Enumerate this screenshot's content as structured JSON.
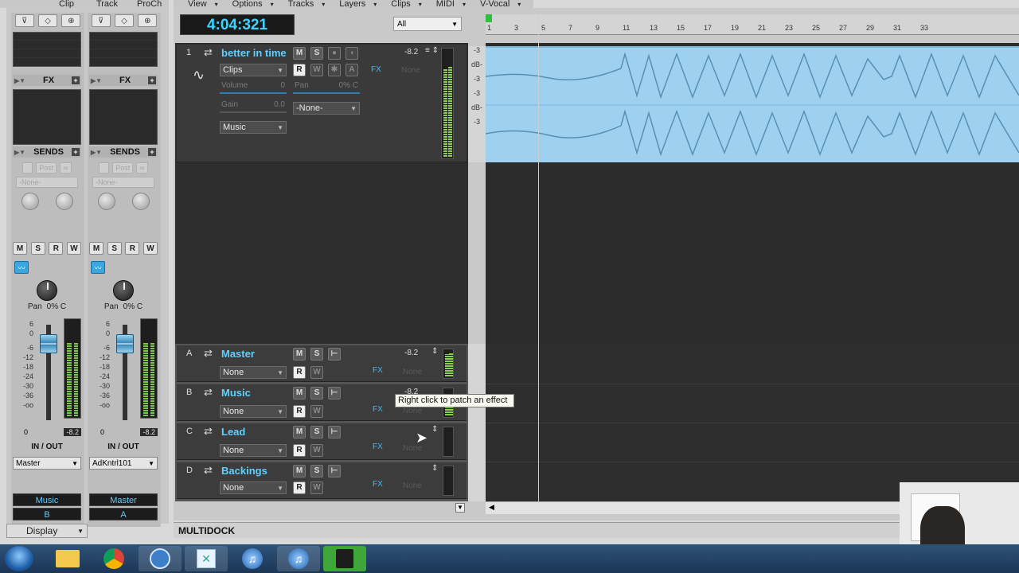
{
  "console_menu": [
    "Clip",
    "Track",
    "ProCh"
  ],
  "trackview_menu": [
    "View",
    "Options",
    "Tracks",
    "Layers",
    "Clips",
    "MIDI",
    "V-Vocal"
  ],
  "strips": [
    {
      "fx_label": "FX",
      "sends_label": "SENDS",
      "send_ghost": "Post",
      "send_none": "-None-",
      "buttons": [
        "M",
        "S",
        "R",
        "W"
      ],
      "pan_label": "Pan",
      "pan_value": "0% C",
      "scale": [
        "6",
        "0",
        "-6",
        "-12",
        "-18",
        "-24",
        "-30",
        "-36",
        "-oo"
      ],
      "fader_value": "0",
      "peak": "-8.2",
      "io_label": "IN / OUT",
      "output": "Master",
      "name": "Music",
      "letter": "B"
    },
    {
      "fx_label": "FX",
      "sends_label": "SENDS",
      "send_ghost": "Post",
      "send_none": "-None-",
      "buttons": [
        "M",
        "S",
        "R",
        "W"
      ],
      "pan_label": "Pan",
      "pan_value": "0% C",
      "scale": [
        "6",
        "0",
        "-6",
        "-12",
        "-18",
        "-24",
        "-30",
        "-36",
        "-oo"
      ],
      "fader_value": "0",
      "peak": "-8.2",
      "io_label": "IN / OUT",
      "output": "AdKntrl101",
      "name": "Master",
      "letter": "A"
    }
  ],
  "display_label": "Display",
  "now_time": "4:04:321",
  "filter": "All",
  "ruler_labels": [
    "1",
    "3",
    "5",
    "7",
    "9",
    "11",
    "13",
    "15",
    "17",
    "19",
    "21",
    "23",
    "25",
    "27",
    "29",
    "31",
    "33"
  ],
  "db_scale": [
    "-3",
    "dB-",
    "-3",
    "-3",
    "dB-",
    "-3"
  ],
  "track": {
    "number": "1",
    "name": "better in time",
    "m": "M",
    "s": "S",
    "value": "-8.2",
    "fx": "FX",
    "none": "None",
    "clips": "Clips",
    "r": "R",
    "w": "W",
    "a": "A",
    "volume_label": "Volume",
    "volume_value": "0",
    "pan_label": "Pan",
    "pan_value": "0% C",
    "gain_label": "Gain",
    "gain_value": "0.0",
    "input": "-None-",
    "output": "Music"
  },
  "buses": [
    {
      "letter": "A",
      "name": "Master",
      "output": "None",
      "value": "-8.2"
    },
    {
      "letter": "B",
      "name": "Music",
      "output": "None",
      "value": "-8.2"
    },
    {
      "letter": "C",
      "name": "Lead",
      "output": "None",
      "value": ""
    },
    {
      "letter": "D",
      "name": "Backings",
      "output": "None",
      "value": ""
    }
  ],
  "bus_common": {
    "m": "M",
    "s": "S",
    "r": "R",
    "w": "W",
    "fx": "FX",
    "none": "None"
  },
  "tooltip": "Right click to patch an effect",
  "multidock": "MULTIDOCK"
}
